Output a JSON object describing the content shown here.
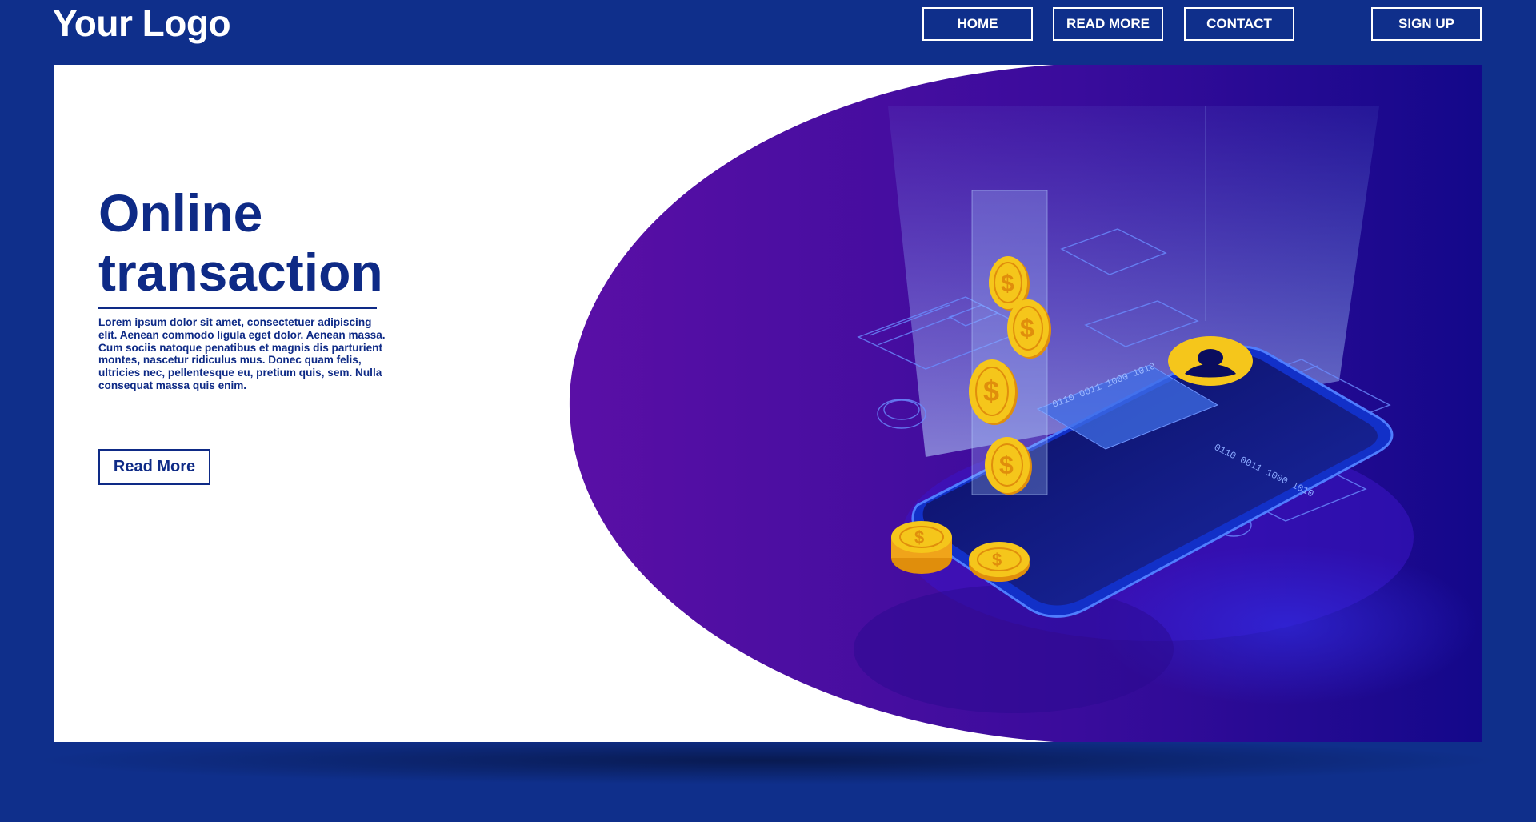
{
  "header": {
    "logo": "Your Logo",
    "nav": {
      "home": "HOME",
      "read_more": "READ MORE",
      "contact": "CONTACT",
      "sign_up": "SIGN UP"
    }
  },
  "hero": {
    "title_line1": "Online",
    "title_line2": "transaction",
    "body": "Lorem ipsum dolor sit amet, consectetuer adipiscing elit. Aenean commodo ligula eget dolor. Aenean massa. Cum sociis natoque penatibus et magnis dis parturient montes, nascetur ridiculus mus. Donec quam felis, ultricies nec, pellentesque eu, pretium quis, sem. Nulla consequat massa quis enim.",
    "cta": "Read More"
  },
  "illustration": {
    "coin_symbol": "$",
    "card_number_1": "0110 0011 1000 1010",
    "card_number_2": "0110 0011 1000 1010"
  },
  "colors": {
    "page_bg": "#0f2f8b",
    "card_bg": "#ffffff",
    "text_primary": "#0e2a86",
    "purple_light": "#5a0fa6",
    "purple_dark": "#1a0a8a",
    "coin": "#f5c61b",
    "coin_dark": "#e08e0c"
  },
  "icons": {
    "coin": "dollar-coin-icon",
    "user": "user-avatar-icon",
    "phone": "smartphone-icon"
  }
}
